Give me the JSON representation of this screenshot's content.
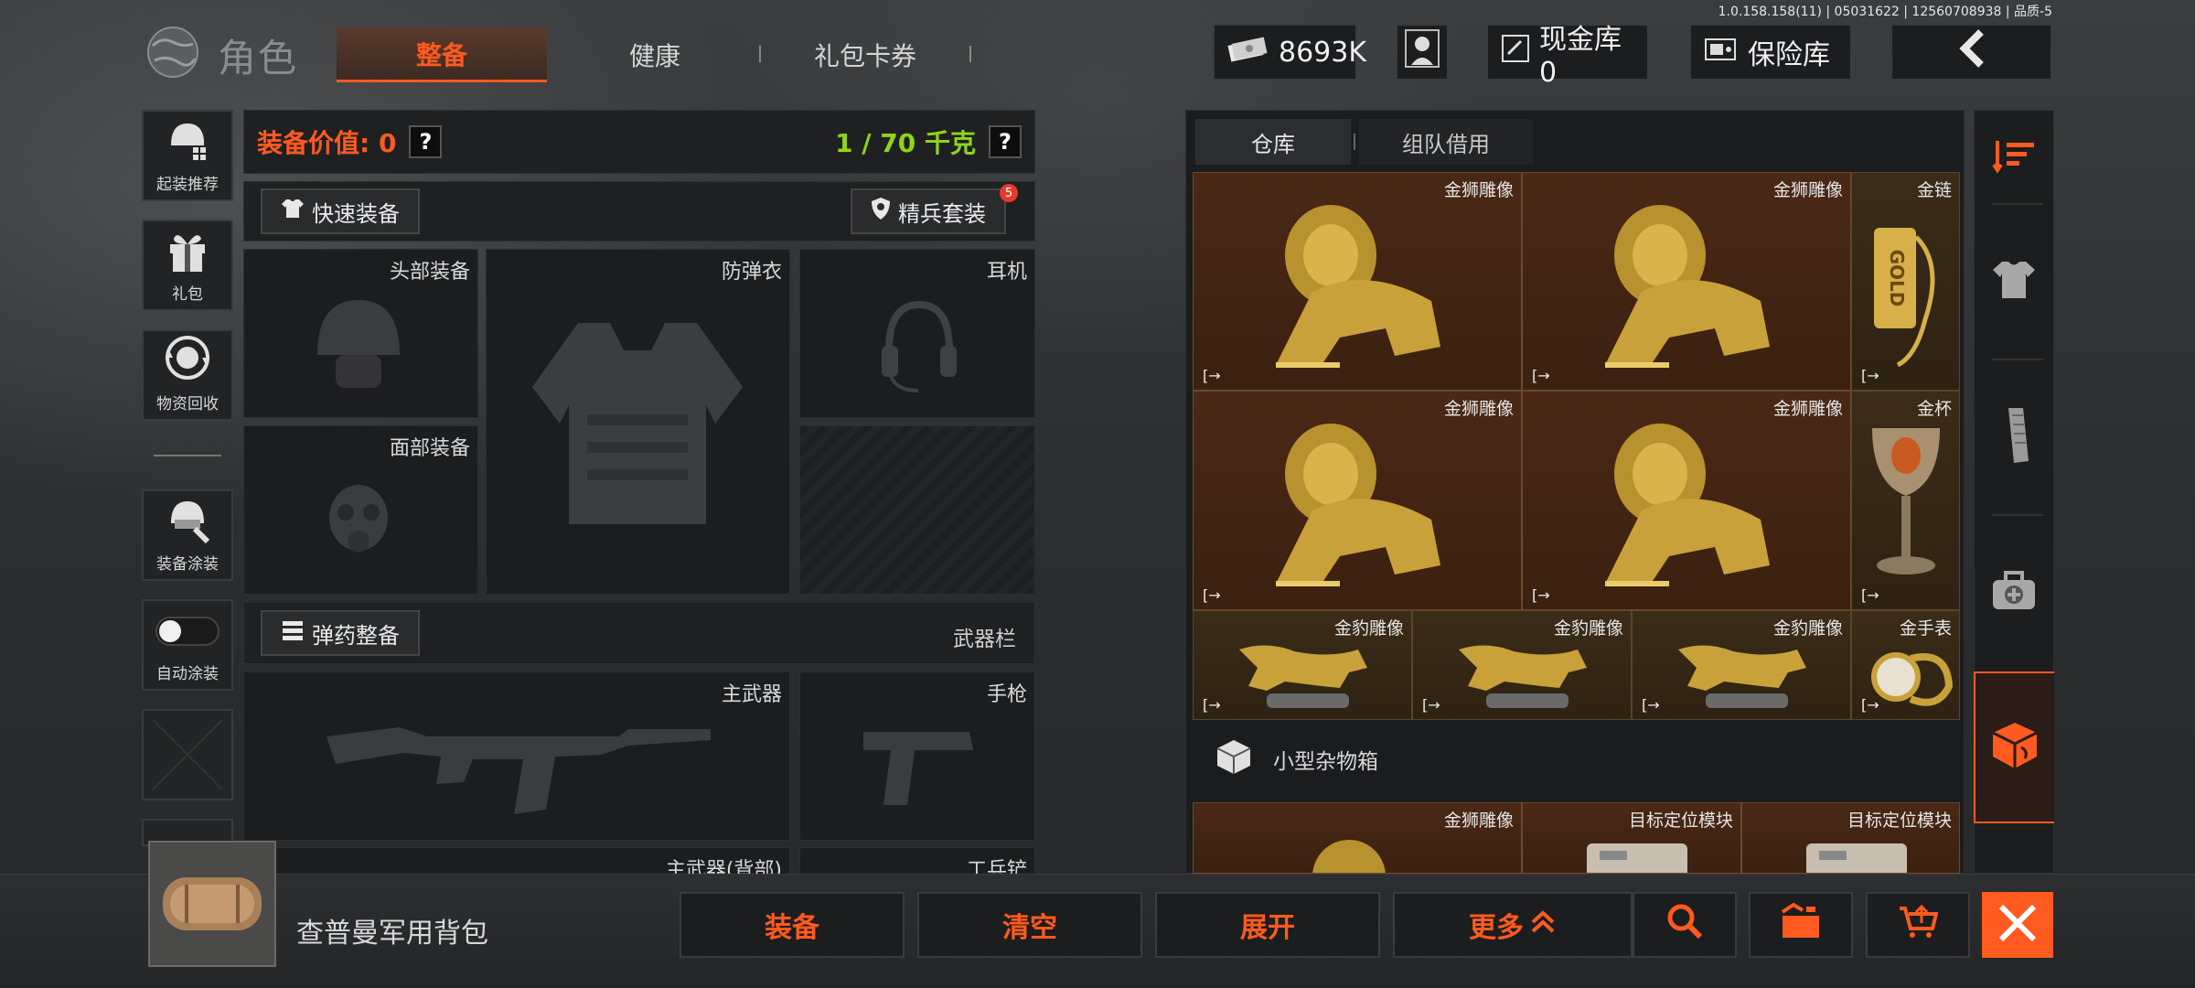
{
  "version": "1.0.158.158(11) | 05031622 | 12560708938 | 品质-5",
  "header": {
    "title": "角色",
    "tabs": [
      {
        "label": "整备",
        "active": true
      },
      {
        "label": "健康",
        "active": false
      },
      {
        "label": "礼包卡券",
        "active": false
      }
    ],
    "money": "8693K",
    "cash_vault": "现金库 0",
    "safe_box": "保险库"
  },
  "sidebar": {
    "items": [
      {
        "label": "起装推荐",
        "icon": "helmet-recommend-icon"
      },
      {
        "label": "礼包",
        "icon": "gift-icon"
      },
      {
        "label": "物资回收",
        "icon": "recycle-icon"
      },
      {
        "label": "装备涂装",
        "icon": "paint-helmet-icon"
      },
      {
        "label": "自动涂装",
        "icon": "toggle-icon",
        "toggle_on": false
      }
    ]
  },
  "equipment": {
    "value_label": "装备价值: 0",
    "weight_label": "1 / 70 千克",
    "help": "?",
    "quick_equip": "快速装备",
    "elite_set": "精兵套装",
    "elite_badge": "5",
    "slots": {
      "head": "头部装备",
      "armor": "防弹衣",
      "headset": "耳机",
      "face": "面部装备",
      "primary": "主武器",
      "pistol": "手枪",
      "primary_back": "主武器(背部)",
      "shovel": "工兵铲",
      "weapon_bar": "武器栏"
    },
    "ammo_btn": "弹药整备"
  },
  "storage": {
    "tabs": [
      {
        "label": "仓库",
        "active": true
      },
      {
        "label": "组队借用",
        "active": false
      }
    ],
    "items": [
      {
        "name": "金狮雕像",
        "icon": "gold-lion-icon"
      },
      {
        "name": "金狮雕像",
        "icon": "gold-lion-icon"
      },
      {
        "name": "金链",
        "icon": "gold-chain-icon"
      },
      {
        "name": "金狮雕像",
        "icon": "gold-lion-icon"
      },
      {
        "name": "金狮雕像",
        "icon": "gold-lion-icon"
      },
      {
        "name": "金杯",
        "icon": "gold-cup-icon"
      },
      {
        "name": "金豹雕像",
        "icon": "gold-leopard-icon"
      },
      {
        "name": "金豹雕像",
        "icon": "gold-leopard-icon"
      },
      {
        "name": "金豹雕像",
        "icon": "gold-leopard-icon"
      },
      {
        "name": "金手表",
        "icon": "gold-watch-icon"
      }
    ],
    "sub_container": "小型杂物箱",
    "sub_items": [
      {
        "name": "金狮雕像"
      },
      {
        "name": "目标定位模块"
      },
      {
        "name": "目标定位模块"
      }
    ],
    "out_symbol": "[→"
  },
  "bottom": {
    "bag_name": "查普曼军用背包",
    "equip": "装备",
    "clear": "清空",
    "expand": "展开",
    "more": "更多",
    "more_glyph": "≪"
  },
  "colors": {
    "accent": "#ff5a1f",
    "green": "#8fd51b",
    "cell_bg": "#4a2816"
  }
}
